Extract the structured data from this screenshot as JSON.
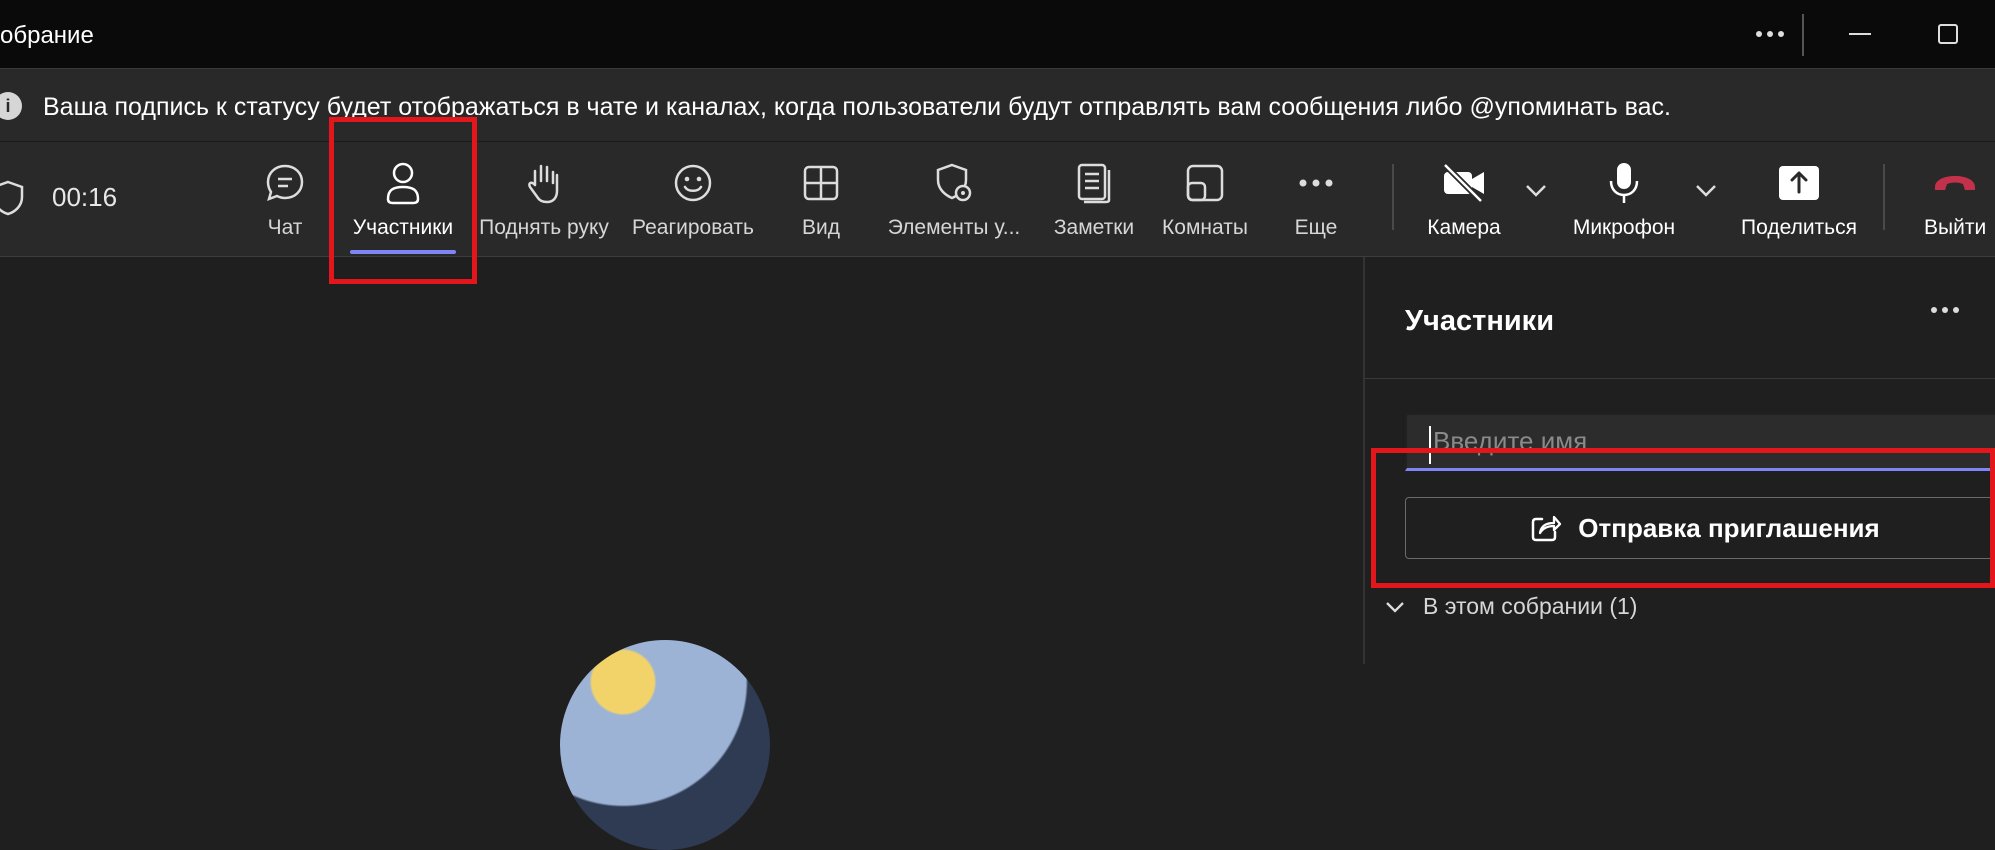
{
  "window": {
    "title": "обрание"
  },
  "banner": {
    "text": "Ваша подпись к статусу будет отображаться в чате и каналах, когда пользователи будут отправлять вам сообщения либо @упоминать вас."
  },
  "toolbar": {
    "timer": "00:16",
    "items": [
      {
        "label": "Чат",
        "icon": "chat-icon"
      },
      {
        "label": "Участники",
        "icon": "people-icon"
      },
      {
        "label": "Поднять руку",
        "icon": "raise-hand-icon"
      },
      {
        "label": "Реагировать",
        "icon": "smiley-icon"
      },
      {
        "label": "Вид",
        "icon": "grid-icon"
      },
      {
        "label": "Элементы у...",
        "icon": "shield-gear-icon"
      },
      {
        "label": "Заметки",
        "icon": "notes-icon"
      },
      {
        "label": "Комнаты",
        "icon": "rooms-icon"
      },
      {
        "label": "Еще",
        "icon": "more-icon"
      },
      {
        "label": "Камера",
        "icon": "camera-off-icon"
      },
      {
        "label": "Микрофон",
        "icon": "microphone-icon"
      },
      {
        "label": "Поделиться",
        "icon": "share-icon"
      },
      {
        "label": "Выйти",
        "icon": "hangup-icon"
      }
    ]
  },
  "participants_panel": {
    "title": "Участники",
    "search_placeholder": "Введите имя",
    "invite_label": "Отправка приглашения",
    "section_label": "В этом собрании (1)"
  },
  "colors": {
    "accent": "#7f85f5",
    "highlight": "#e3161b",
    "hangup": "#c4314b"
  }
}
